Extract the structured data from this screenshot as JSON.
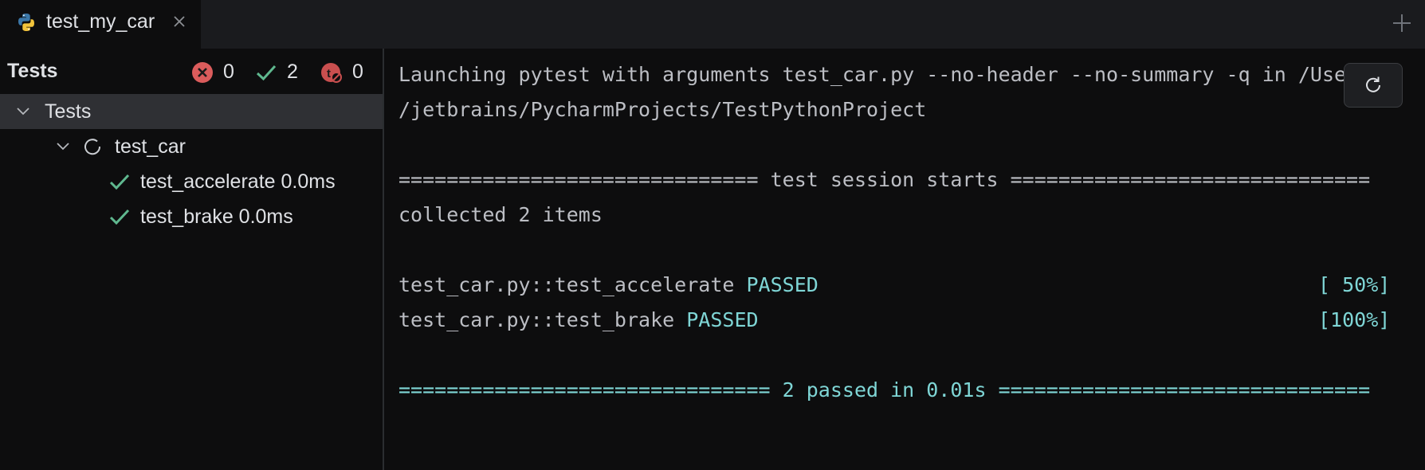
{
  "tab": {
    "label": "test_my_car",
    "icon": "python-file-icon"
  },
  "tests_panel": {
    "title": "Tests",
    "counters": {
      "failed": "0",
      "passed": "2",
      "ignored": "0"
    },
    "tree": {
      "root_label": "Tests",
      "module_label": "test_car",
      "tests": [
        {
          "label": "test_accelerate 0.0ms",
          "status": "passed"
        },
        {
          "label": "test_brake 0.0ms",
          "status": "passed"
        }
      ]
    }
  },
  "console": {
    "line1": "Launching pytest with arguments test_car.py --no-header --no-summary -q in /Users",
    "line2": "/jetbrains/PycharmProjects/TestPythonProject",
    "session_start": "============================== test session starts ==============================",
    "collected": "collected 2 items",
    "results": [
      {
        "name": "test_car.py::test_accelerate",
        "status": "PASSED",
        "progress": "[ 50%]"
      },
      {
        "name": "test_car.py::test_brake",
        "status": "PASSED",
        "progress": "[100%]"
      }
    ],
    "summary": "=============================== 2 passed in 0.01s ==============================="
  },
  "colors": {
    "passed": "#5fb88f",
    "failed": "#db5c5c",
    "console_teal": "#7fd6d6"
  }
}
